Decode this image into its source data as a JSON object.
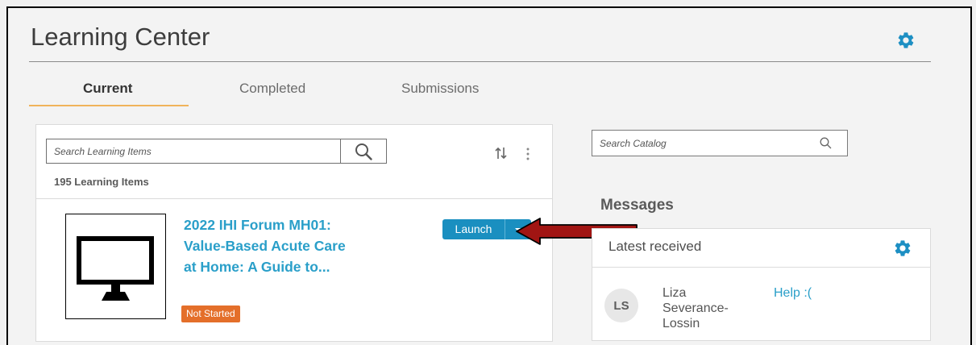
{
  "app": {
    "title": "Learning Center",
    "accent": "#2a9fc9",
    "tab_accent": "#f0b35b",
    "gear_icon": "gear-icon"
  },
  "tabs": [
    {
      "label": "Current",
      "active": true
    },
    {
      "label": "Completed",
      "active": false
    },
    {
      "label": "Submissions",
      "active": false
    }
  ],
  "learning": {
    "search_placeholder": "Search Learning Items",
    "search_icon": "search-icon",
    "count_label": "195 Learning Items",
    "sort_icon": "sort-icon",
    "more_icon": "more-vertical-icon",
    "item": {
      "thumbnail_icon": "monitor-icon",
      "title_lines": [
        "2022 IHI Forum MH01:",
        "Value-Based Acute Care",
        "at Home: A Guide to..."
      ],
      "status": "Not Started",
      "status_color": "#e46f2a",
      "launch_label": "Launch",
      "launch_color": "#1a8fc0"
    }
  },
  "annotation": {
    "arrow_color": "#a11513",
    "arrow_icon": "left-arrow-icon"
  },
  "catalog": {
    "search_placeholder": "Search Catalog",
    "search_icon": "search-icon"
  },
  "messages": {
    "heading": "Messages",
    "panel_title": "Latest received",
    "items": [
      {
        "initials": "LS",
        "sender_lines": [
          "Liza",
          "Severance-",
          "Lossin"
        ],
        "subject": "Help :("
      }
    ]
  }
}
